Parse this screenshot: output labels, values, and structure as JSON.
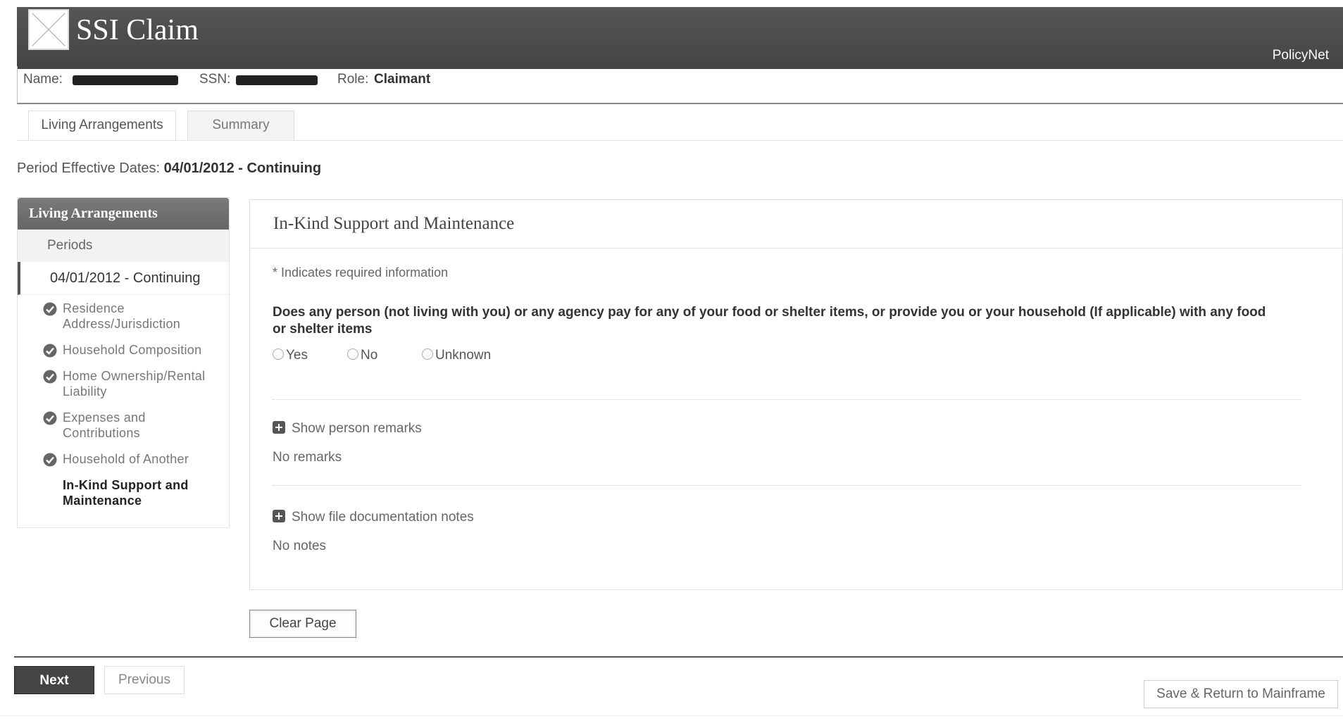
{
  "header": {
    "app_title": "SSI Claim",
    "policynet_label": "PolicyNet",
    "logo_icon": "x-logo-icon"
  },
  "info_bar": {
    "name_label": "Name:",
    "ssn_label": "SSN:",
    "role_label": "Role:",
    "role_value": "Claimant"
  },
  "tabs": [
    {
      "label": "Living Arrangements",
      "active": true
    },
    {
      "label": "Summary",
      "active": false
    }
  ],
  "period": {
    "label": "Period Effective Dates:",
    "value": "04/01/2012 - Continuing"
  },
  "sidebar": {
    "heading": "Living Arrangements",
    "periods_label": "Periods",
    "selected_period": "04/01/2012 - Continuing",
    "items": [
      {
        "label": "Residence Address/Jurisdiction",
        "completed": true
      },
      {
        "label": "Household Composition",
        "completed": true
      },
      {
        "label": "Home Ownership/Rental Liability",
        "completed": true
      },
      {
        "label": "Expenses and Contributions",
        "completed": true
      },
      {
        "label": "Household of Another",
        "completed": true
      },
      {
        "label": "In-Kind Support and Maintenance",
        "completed": false,
        "current": true
      }
    ]
  },
  "main": {
    "title": "In-Kind Support and Maintenance",
    "required_note": "* Indicates required information",
    "question": "Does any person (not living with you) or any agency pay for any of your food or shelter items, or provide you or your household (If applicable) with any food or shelter items",
    "options": [
      "Yes",
      "No",
      "Unknown"
    ],
    "person_remarks_toggle": "Show person remarks",
    "person_remarks_value": "No remarks",
    "file_notes_toggle": "Show file documentation notes",
    "file_notes_value": "No notes"
  },
  "buttons": {
    "clear_page": "Clear Page",
    "next": "Next",
    "previous": "Previous",
    "save_return": "Save & Return to Mainframe"
  },
  "colors": {
    "header_bg": "#4d4d4d",
    "sidebar_head_bg": "#707070",
    "next_bg": "#444444"
  }
}
